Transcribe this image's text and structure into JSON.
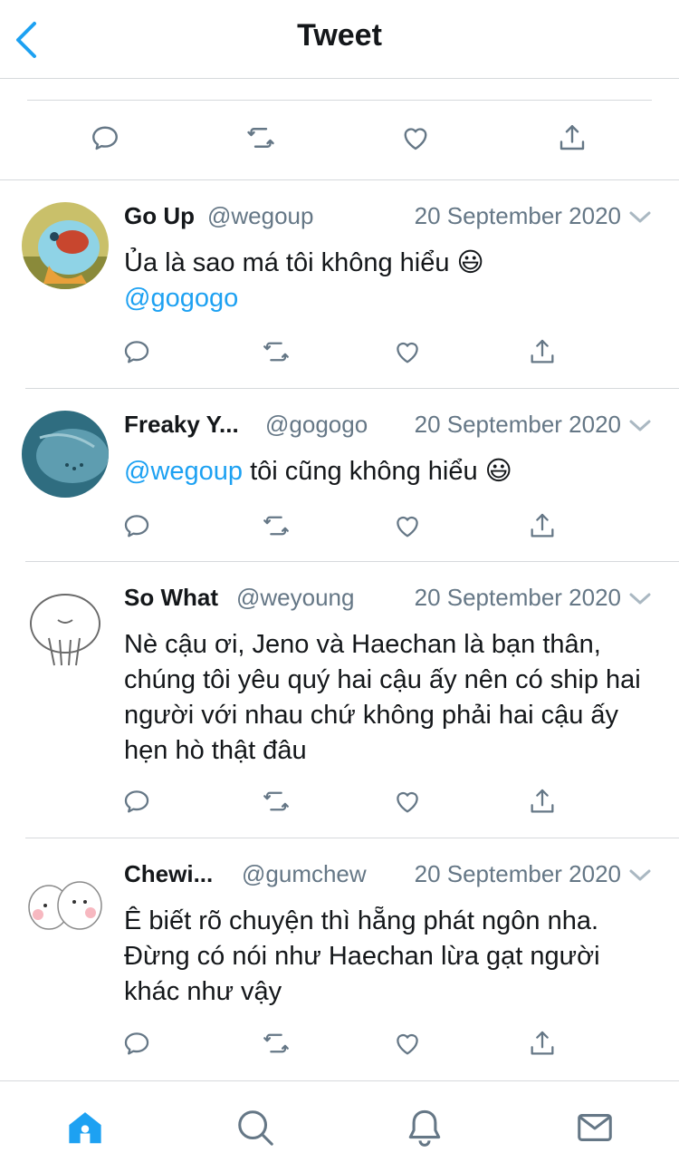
{
  "header": {
    "title": "Tweet"
  },
  "colors": {
    "accent": "#1da1f2",
    "icon": "#657786",
    "text": "#14171a",
    "separator": "#d6d9dc"
  },
  "top_actions": [
    "reply-icon",
    "retweet-icon",
    "like-icon",
    "share-icon"
  ],
  "replies": [
    {
      "name": "Go Up",
      "handle": "@wegoup",
      "date": "20 September 2020",
      "text": "Ủa là sao má tôi không hiểu 😃",
      "mention": "@gogogo"
    },
    {
      "name": "Freaky Y...",
      "handle": "@gogogo",
      "date": "20 September 2020",
      "mention": "@wegoup",
      "text": " tôi cũng không hiểu 😃"
    },
    {
      "name": "So What",
      "handle": "@weyoung",
      "date": "20 September 2020",
      "text": "Nè cậu ơi, Jeno và Haechan là bạn thân, chúng tôi yêu quý hai cậu ấy nên có ship hai người với nhau chứ không phải hai cậu ấy hẹn hò thật đâu"
    },
    {
      "name": "Chewi...",
      "handle": "@gumchew",
      "date": "20 September 2020",
      "text": "Ê biết rõ chuyện thì hẵng phát ngôn nha. Đừng có nói như Haechan lừa gạt người khác như vậy"
    }
  ],
  "tabbar": [
    "home-icon",
    "search-icon",
    "notifications-icon",
    "messages-icon"
  ]
}
